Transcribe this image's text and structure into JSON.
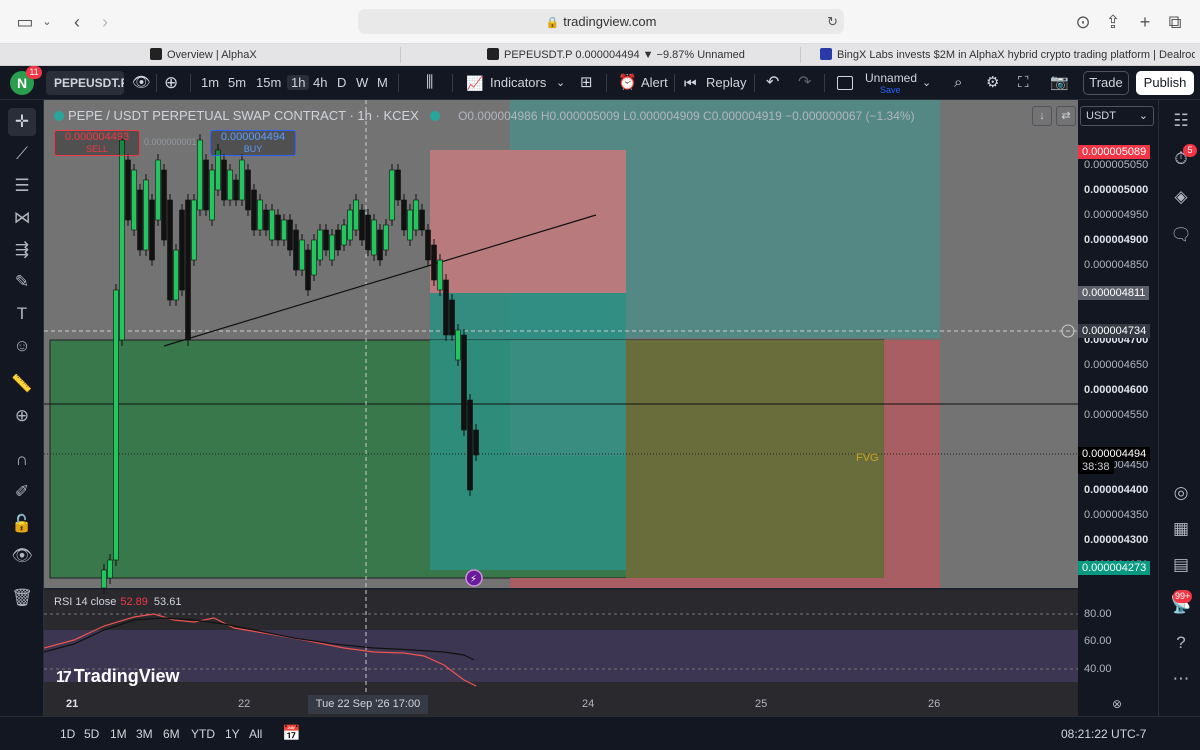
{
  "browser": {
    "url": "tradingview.com",
    "tabs": [
      {
        "title": "Overview | AlphaX"
      },
      {
        "title": "PEPEUSDT.P 0.000004494 ▼ −9.87% Unnamed"
      },
      {
        "title": "BingX Labs invests $2M in AlphaX hybrid crypto trading platform | Dealroom.co"
      }
    ]
  },
  "toolbar": {
    "notification_count": "11",
    "symbol": "PEPEUSDT.P",
    "intervals": [
      "1m",
      "5m",
      "15m",
      "1h",
      "4h",
      "D",
      "W",
      "M"
    ],
    "active_interval": "1h",
    "indicators_label": "Indicators",
    "alert_label": "Alert",
    "replay_label": "Replay",
    "layout_name": "Unnamed",
    "layout_save": "Save",
    "trade_label": "Trade",
    "publish_label": "Publish"
  },
  "legend": {
    "title": "PEPE / USDT PERPETUAL SWAP CONTRACT · 1h · KCEX",
    "open": "O0.000004986",
    "high": "H0.000005009",
    "low": "L0.000004909",
    "close": "C0.000004919",
    "change": "−0.000000067 (−1.34%)"
  },
  "order": {
    "sell_price": "0.000004493",
    "sell_label": "SELL",
    "buy_price": "0.000004494",
    "buy_label": "BUY",
    "spread": "0.000000001"
  },
  "currency": "USDT",
  "price_axis": {
    "labels": [
      {
        "v": "0.000005050",
        "bold": false
      },
      {
        "v": "0.000005000",
        "bold": true
      },
      {
        "v": "0.000004950",
        "bold": false
      },
      {
        "v": "0.000004900",
        "bold": true
      },
      {
        "v": "0.000004850",
        "bold": false
      },
      {
        "v": "0.000004700",
        "bold": true
      },
      {
        "v": "0.000004650",
        "bold": false
      },
      {
        "v": "0.000004600",
        "bold": true
      },
      {
        "v": "0.000004550",
        "bold": false
      },
      {
        "v": "0.000004450",
        "bold": false
      },
      {
        "v": "0.000004400",
        "bold": true
      },
      {
        "v": "0.000004350",
        "bold": false
      },
      {
        "v": "0.000004300",
        "bold": true
      },
      {
        "v": "0.000004250",
        "bold": false
      }
    ],
    "tag_top": "0.000005089",
    "tag_mid": "0.000004811",
    "tag_cross": "0.000004734",
    "tag_last": "0.000004494",
    "tag_timer": "38:38",
    "tag_bottom": "0.000004273"
  },
  "fvg_label": "FVG",
  "rsi": {
    "name": "RSI 14 close",
    "value1": "52.89",
    "value2": "53.61",
    "levels": [
      "80.00",
      "60.00",
      "40.00"
    ]
  },
  "brand": "TradingView",
  "time_axis": {
    "labels": [
      "21",
      "22",
      "24",
      "25",
      "26"
    ],
    "crosshair": "Tue 22 Sep '26   17:00"
  },
  "bottom": {
    "ranges": [
      "1D",
      "5D",
      "1M",
      "3M",
      "6M",
      "YTD",
      "1Y",
      "All"
    ],
    "clock": "08:21:22 UTC-7"
  },
  "right_badges": {
    "alerts": "5",
    "chat": "99+"
  },
  "colors": {
    "up": "#26a69a",
    "down": "#ef5350",
    "bg": "#131722",
    "accent": "#2962ff"
  }
}
